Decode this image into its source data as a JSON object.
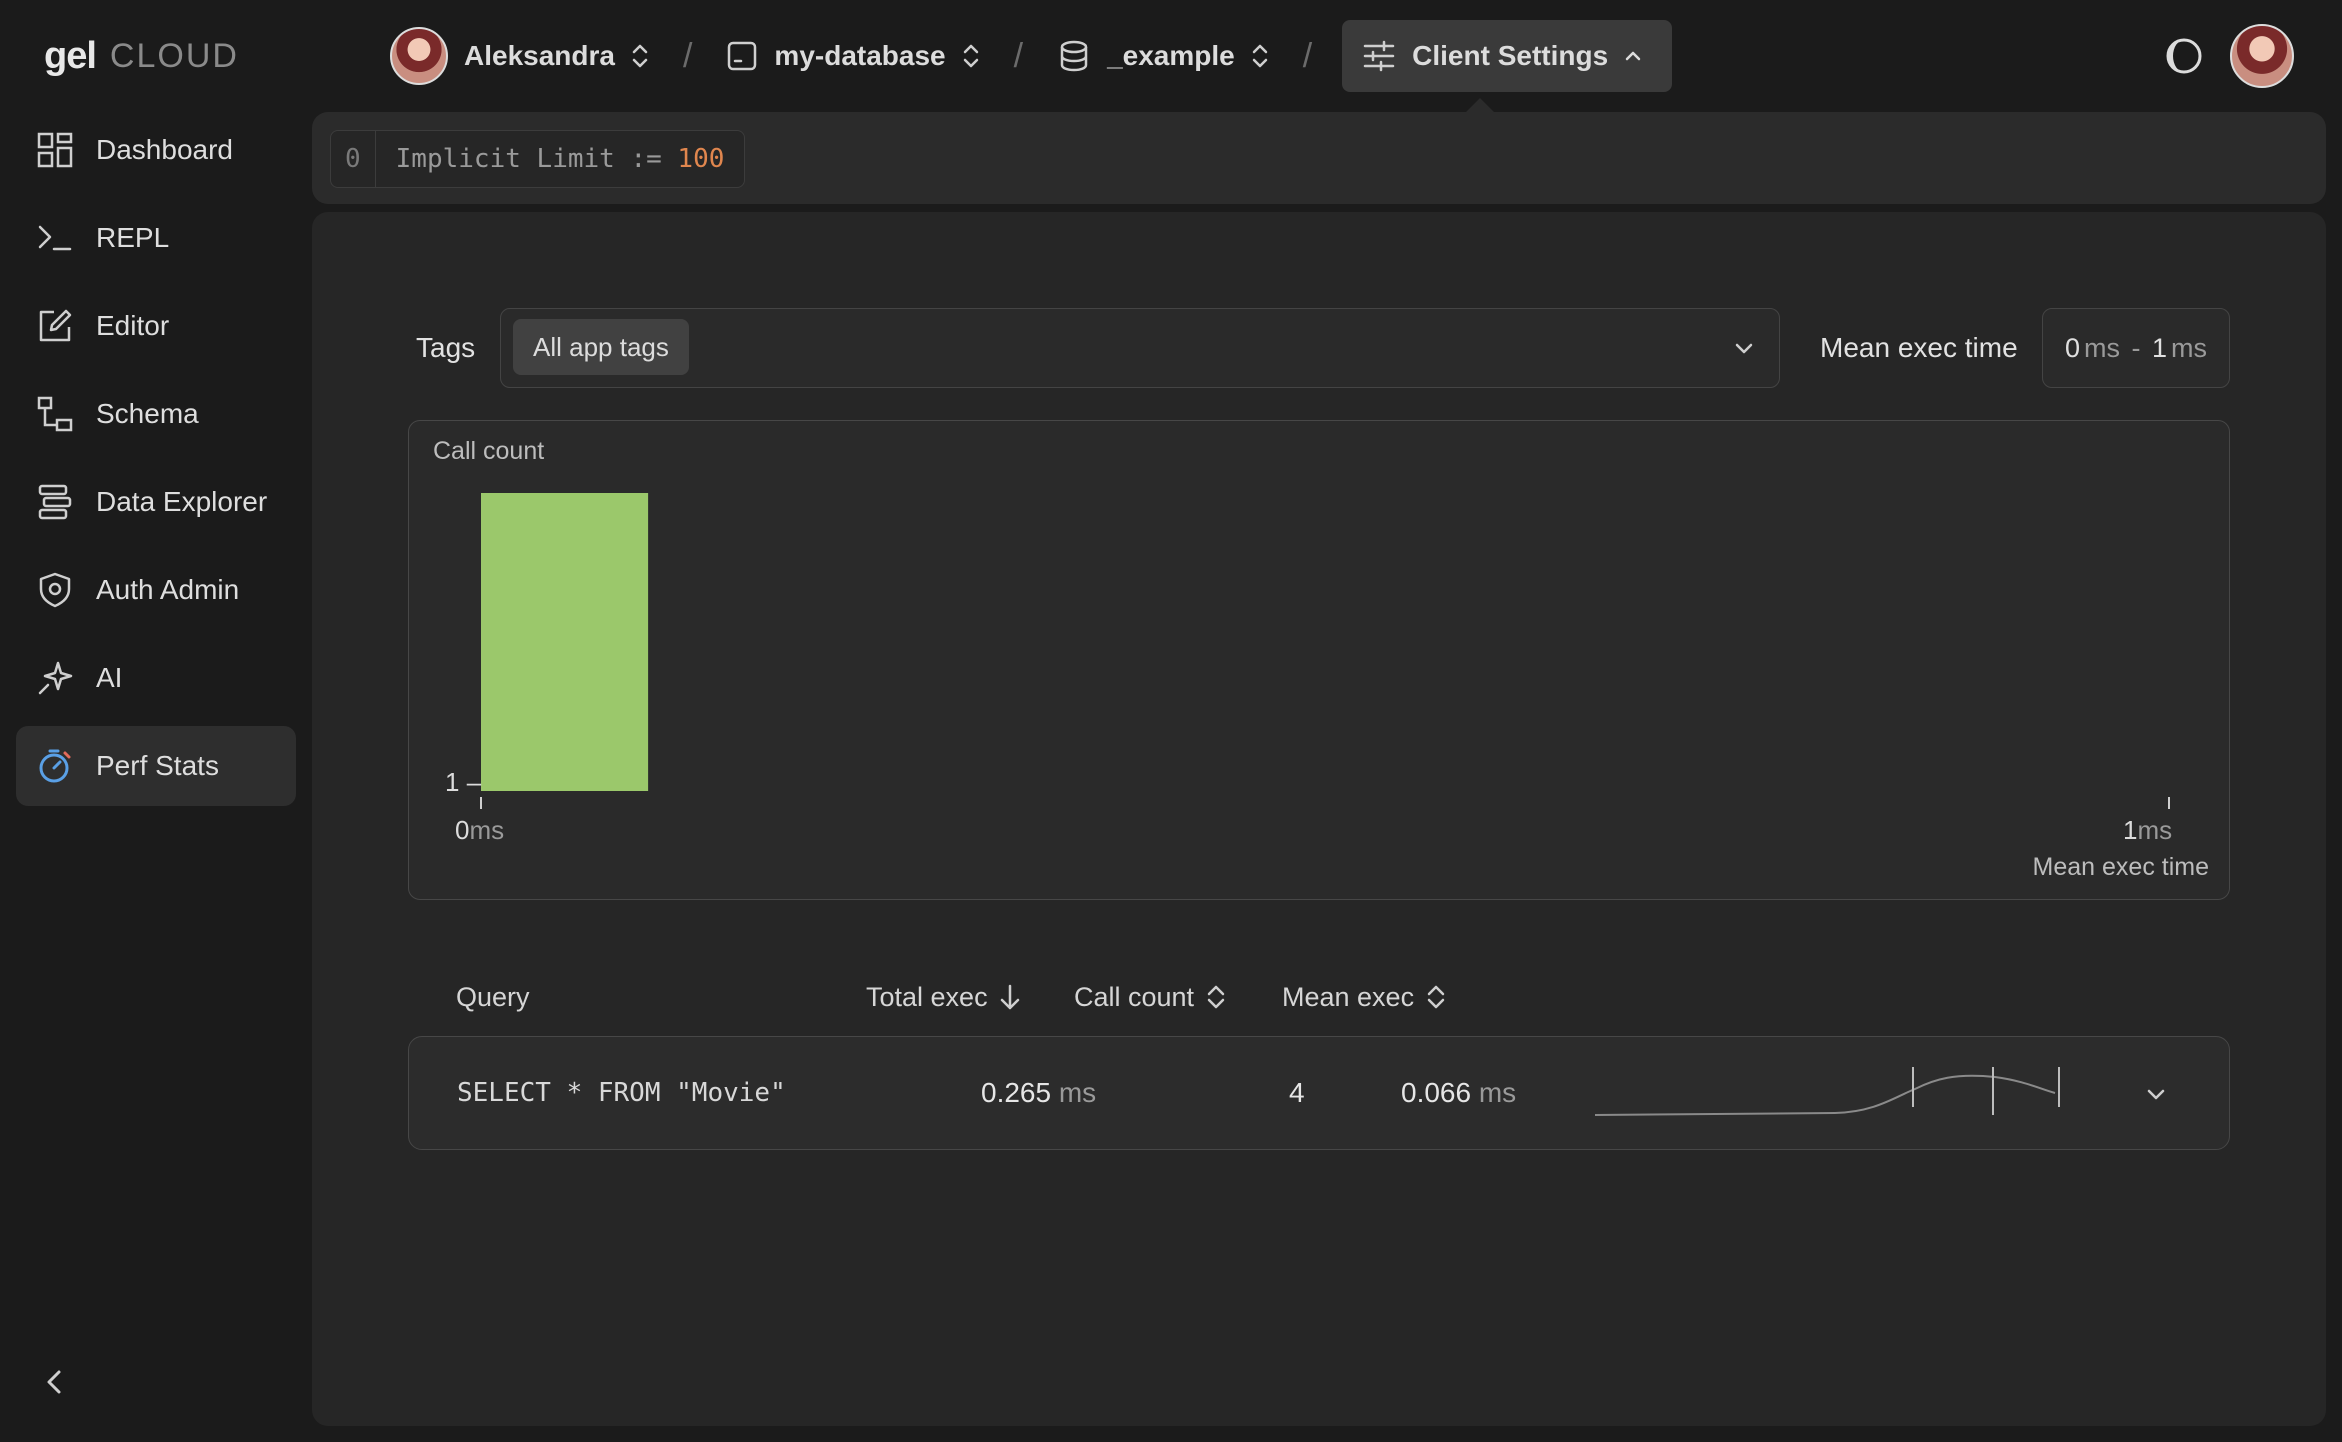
{
  "brand": {
    "logo_text": "gel",
    "cloud_text": "CLOUD"
  },
  "breadcrumb": {
    "user": "Aleksandra",
    "instance": "my-database",
    "branch": "_example",
    "settings": "Client Settings"
  },
  "sidebar": {
    "items": [
      {
        "label": "Dashboard",
        "icon": "dashboard-icon"
      },
      {
        "label": "REPL",
        "icon": "terminal-icon"
      },
      {
        "label": "Editor",
        "icon": "editor-icon"
      },
      {
        "label": "Schema",
        "icon": "schema-icon"
      },
      {
        "label": "Data Explorer",
        "icon": "data-explorer-icon"
      },
      {
        "label": "Auth Admin",
        "icon": "shield-icon"
      },
      {
        "label": "AI",
        "icon": "sparkle-icon"
      },
      {
        "label": "Perf Stats",
        "icon": "stopwatch-icon",
        "active": true
      }
    ]
  },
  "client_settings": {
    "index": "0",
    "expr_prefix": "Implicit Limit := ",
    "value": "100"
  },
  "filters": {
    "tags_label": "Tags",
    "tags_value": "All app tags",
    "mean_exec_label": "Mean exec time",
    "range_from": "0",
    "range_to": "1",
    "range_unit": "ms",
    "range_sep": " - "
  },
  "chart_data": {
    "type": "bar",
    "ylabel": "Call count",
    "xlabel": "Mean exec time",
    "x_ticks": [
      {
        "num": "0",
        "unit": "ms"
      },
      {
        "num": "1",
        "unit": "ms"
      }
    ],
    "y_ticks": [
      "1"
    ],
    "bars": [
      {
        "x_from": 0,
        "x_to": 0.1,
        "value": 1
      }
    ],
    "xlim": [
      0,
      1
    ],
    "color": "#9bc86b",
    "grid": false
  },
  "table": {
    "headers": {
      "query": "Query",
      "total_exec": "Total exec",
      "call_count": "Call count",
      "mean_exec": "Mean exec"
    },
    "rows": [
      {
        "query": "SELECT * FROM \"Movie\"",
        "total_exec": "0.265",
        "total_unit": "ms",
        "call_count": "4",
        "mean_exec": "0.066",
        "mean_unit": "ms"
      }
    ]
  },
  "colors": {
    "background": "#1b1b1b",
    "panel": "#262626",
    "accent_bar": "#9bc86b",
    "limit_value": "#e0864e"
  }
}
